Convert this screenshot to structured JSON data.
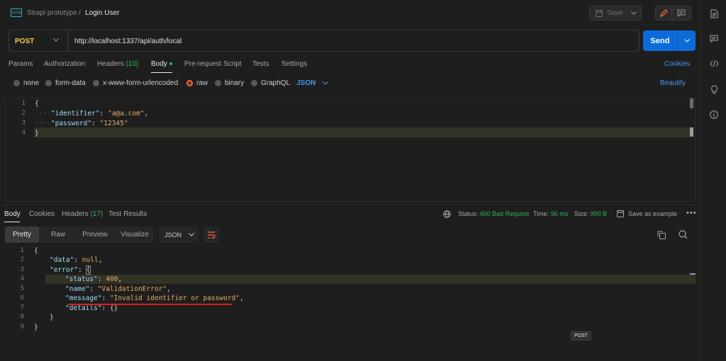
{
  "header": {
    "workspace": "Strapi prototype",
    "separator": "/",
    "title": "Login User",
    "save_label": "Save"
  },
  "request": {
    "method": "POST",
    "url": "http://localhost:1337/api/auth/local",
    "send_label": "Send"
  },
  "request_tabs": {
    "params": "Params",
    "authorization": "Authorization",
    "headers": "Headers",
    "headers_count": "(10)",
    "body": "Body",
    "pre_request": "Pre-request Script",
    "tests": "Tests",
    "settings": "Settings",
    "cookies": "Cookies"
  },
  "body_types": {
    "none": "none",
    "form_data": "form-data",
    "urlencoded": "x-www-form-urlencoded",
    "raw": "raw",
    "binary": "binary",
    "graphql": "GraphQL",
    "format": "JSON",
    "beautify": "Beautify"
  },
  "request_body": {
    "line_numbers": [
      "1",
      "2",
      "3",
      "4"
    ],
    "open": "{",
    "identifier_key": "\"identifier\"",
    "identifier_value": "\"a@a.com\"",
    "password_key": "\"password\"",
    "password_value": "\"12345\"",
    "close": "}"
  },
  "response_tabs": {
    "body": "Body",
    "cookies": "Cookies",
    "headers": "Headers",
    "headers_count": "(17)",
    "test_results": "Test Results"
  },
  "response_meta": {
    "status_label": "Status:",
    "status_value": "400 Bad Request",
    "time_label": "Time:",
    "time_value": "96 ms",
    "size_label": "Size:",
    "size_value": "990 B",
    "save_example": "Save as example"
  },
  "view_modes": {
    "pretty": "Pretty",
    "raw": "Raw",
    "preview": "Preview",
    "visualize": "Visualize",
    "format": "JSON"
  },
  "response_body": {
    "line_numbers": [
      "1",
      "2",
      "3",
      "4",
      "5",
      "6",
      "7",
      "8",
      "9"
    ],
    "l1": "{",
    "data_key": "\"data\"",
    "data_value": "null",
    "error_key": "\"error\"",
    "error_open": "{",
    "status_key": "\"status\"",
    "status_value": "400",
    "name_key": "\"name\"",
    "name_value": "\"ValidationError\"",
    "message_key": "\"message\"",
    "message_value": "\"Invalid identifier or password\"",
    "details_key": "\"details\"",
    "details_value": "{}",
    "l8": "}",
    "l9": "}"
  },
  "tooltip": "POST",
  "colors": {
    "accent": "#ff6c37",
    "send": "#0d6bd9",
    "link": "#4a95e8",
    "method": "#ffcc4d",
    "ok": "#2ab85c",
    "annotation": "#e02020"
  }
}
